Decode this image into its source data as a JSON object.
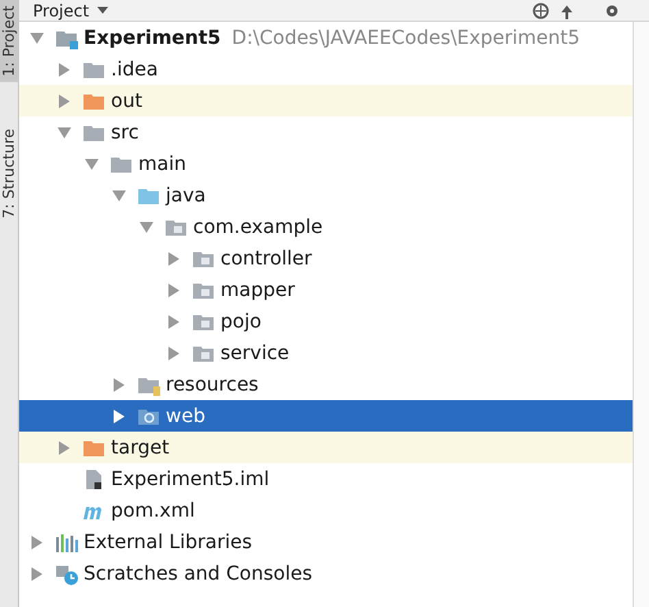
{
  "tool_window": {
    "title": "Project"
  },
  "side_tabs": [
    {
      "label": "1: Project",
      "selected": true
    },
    {
      "label": "7: Structure",
      "selected": false
    }
  ],
  "tree": [
    {
      "label": "Experiment5",
      "path": "D:\\Codes\\JAVAEECodes\\Experiment5",
      "kind": "module",
      "expanded": true,
      "selected": false,
      "excluded": false,
      "children": [
        {
          "label": ".idea",
          "kind": "folder",
          "expanded": false,
          "selected": false,
          "excluded": false
        },
        {
          "label": "out",
          "kind": "excluded-folder",
          "expanded": false,
          "selected": false,
          "excluded": true
        },
        {
          "label": "src",
          "kind": "folder",
          "expanded": true,
          "selected": false,
          "excluded": false,
          "children": [
            {
              "label": "main",
              "kind": "folder",
              "expanded": true,
              "selected": false,
              "excluded": false,
              "children": [
                {
                  "label": "java",
                  "kind": "source",
                  "expanded": true,
                  "selected": false,
                  "excluded": false,
                  "children": [
                    {
                      "label": "com.example",
                      "kind": "package",
                      "expanded": true,
                      "selected": false,
                      "excluded": false,
                      "children": [
                        {
                          "label": "controller",
                          "kind": "package",
                          "expanded": false,
                          "selected": false,
                          "excluded": false
                        },
                        {
                          "label": "mapper",
                          "kind": "package",
                          "expanded": false,
                          "selected": false,
                          "excluded": false
                        },
                        {
                          "label": "pojo",
                          "kind": "package",
                          "expanded": false,
                          "selected": false,
                          "excluded": false
                        },
                        {
                          "label": "service",
                          "kind": "package",
                          "expanded": false,
                          "selected": false,
                          "excluded": false
                        }
                      ]
                    }
                  ]
                },
                {
                  "label": "resources",
                  "kind": "resources",
                  "expanded": false,
                  "selected": false,
                  "excluded": false
                },
                {
                  "label": "web",
                  "kind": "web",
                  "expanded": false,
                  "selected": true,
                  "excluded": false
                }
              ]
            }
          ]
        },
        {
          "label": "target",
          "kind": "excluded-folder",
          "expanded": false,
          "selected": false,
          "excluded": true
        },
        {
          "label": "Experiment5.iml",
          "kind": "iml",
          "selected": false,
          "excluded": false
        },
        {
          "label": "pom.xml",
          "kind": "maven",
          "selected": false,
          "excluded": false
        }
      ]
    },
    {
      "label": "External Libraries",
      "kind": "libraries",
      "expanded": false,
      "selected": false,
      "excluded": false
    },
    {
      "label": "Scratches and Consoles",
      "kind": "scratches",
      "expanded": false,
      "selected": false,
      "excluded": false
    }
  ]
}
